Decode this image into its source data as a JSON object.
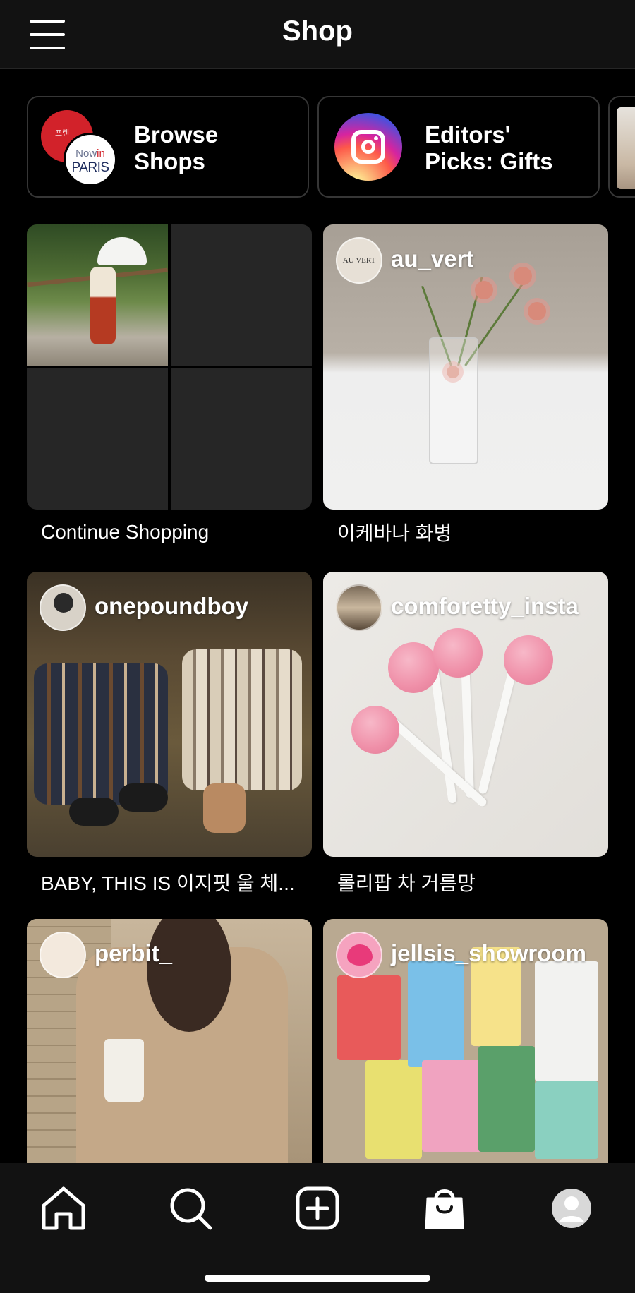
{
  "header": {
    "title": "Shop"
  },
  "shop_cards": [
    {
      "label": "Browse\nShops",
      "logo_text": "Now in PARIS",
      "logo_now": "Now",
      "logo_in": "in",
      "logo_paris": "PARIS"
    },
    {
      "label": "Editors'\nPicks: Gifts"
    }
  ],
  "tiles": {
    "continue": {
      "caption": "Continue Shopping"
    },
    "auvert": {
      "username": "au_vert",
      "avatar_text": "AU VERT",
      "caption": "이케바나 화병"
    },
    "onepoundboy": {
      "username": "onepoundboy",
      "caption": "BABY, THIS IS 이지핏 울 체..."
    },
    "comforetty": {
      "username": "comforetty_insta",
      "caption": "롤리팝 차 거름망"
    },
    "perbit": {
      "username": "perbit_"
    },
    "jellsis": {
      "username": "jellsis_showroom"
    }
  },
  "colors": {
    "background": "#000000",
    "header_bg": "#121212",
    "card_border": "#363636",
    "accent_red": "#d2222a"
  },
  "bottom_nav": [
    "home-icon",
    "search-icon",
    "new-post-icon",
    "shop-icon",
    "profile-icon"
  ]
}
